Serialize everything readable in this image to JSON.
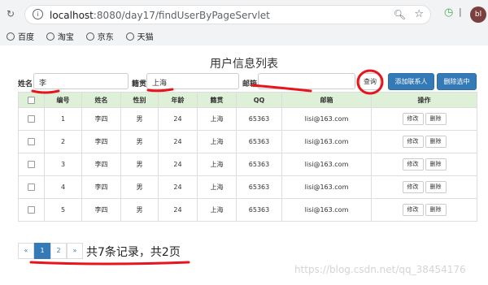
{
  "browser": {
    "url_host": "localhost",
    "url_path": ":8080/day17/findUserByPageServlet",
    "avatar_text": "bl",
    "bookmarks": [
      "百度",
      "淘宝",
      "京东",
      "天猫"
    ]
  },
  "page": {
    "title": "用户信息列表"
  },
  "search": {
    "name_label": "姓名",
    "name_value": "李",
    "native_label": "籍贯",
    "native_value": "上海",
    "email_label": "邮箱",
    "email_value": "",
    "query_button": "查询",
    "add_button": "添加联系人",
    "delete_selected_button": "删除选中"
  },
  "table": {
    "headers": [
      "",
      "编号",
      "姓名",
      "性别",
      "年龄",
      "籍贯",
      "QQ",
      "邮箱",
      "操作"
    ],
    "rows": [
      {
        "id": "1",
        "name": "李四",
        "gender": "男",
        "age": "24",
        "native": "上海",
        "qq": "65363",
        "email": "lisi@163.com"
      },
      {
        "id": "2",
        "name": "李四",
        "gender": "男",
        "age": "24",
        "native": "上海",
        "qq": "65363",
        "email": "lisi@163.com"
      },
      {
        "id": "3",
        "name": "李四",
        "gender": "男",
        "age": "24",
        "native": "上海",
        "qq": "65363",
        "email": "lisi@163.com"
      },
      {
        "id": "4",
        "name": "李四",
        "gender": "男",
        "age": "24",
        "native": "上海",
        "qq": "65363",
        "email": "lisi@163.com"
      },
      {
        "id": "5",
        "name": "李四",
        "gender": "男",
        "age": "24",
        "native": "上海",
        "qq": "65363",
        "email": "lisi@163.com"
      }
    ],
    "edit_label": "修改",
    "delete_label": "删除"
  },
  "pagination": {
    "prev": "«",
    "pages": [
      "1",
      "2"
    ],
    "current": "1",
    "next": "»",
    "summary": "共7条记录，共2页"
  },
  "watermark": "https://blog.csdn.net/qq_38454176",
  "colors": {
    "primary": "#337ab7",
    "header_bg": "#dff0d8",
    "annotation": "#e8141c"
  }
}
